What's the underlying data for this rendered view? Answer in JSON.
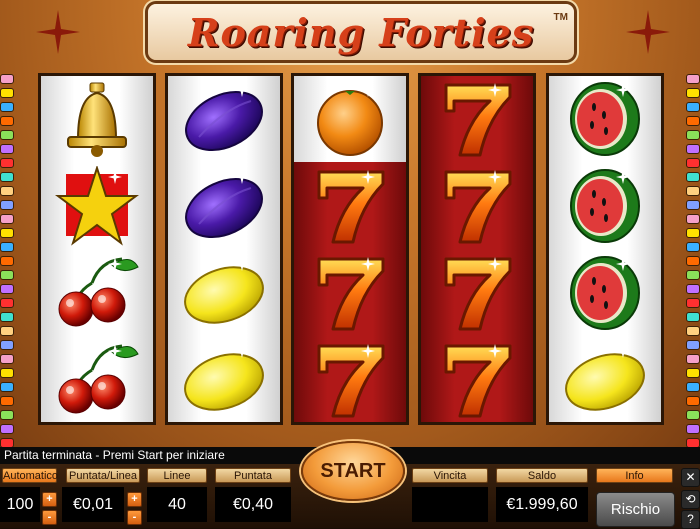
{
  "game": {
    "title": "Roaring Forties",
    "trademark": "TM"
  },
  "reels": [
    {
      "background": "white",
      "symbols": [
        "bell",
        "star",
        "cherries",
        "cherries"
      ]
    },
    {
      "background": "white",
      "symbols": [
        "plum",
        "plum",
        "lemon",
        "lemon"
      ]
    },
    {
      "background": "red",
      "symbols": [
        "orange",
        "seven",
        "seven",
        "seven"
      ]
    },
    {
      "background": "red",
      "symbols": [
        "seven",
        "seven",
        "seven",
        "seven"
      ]
    },
    {
      "background": "white",
      "symbols": [
        "watermelon",
        "watermelon",
        "watermelon",
        "lemon"
      ]
    }
  ],
  "status": {
    "message": "Partita terminata - Premi Start per iniziare"
  },
  "controls": {
    "auto": {
      "label": "Automatico",
      "value": "100"
    },
    "bet_per_line": {
      "label": "Puntata/Linea",
      "value": "€0,01"
    },
    "lines": {
      "label": "Linee",
      "value": "40"
    },
    "bet": {
      "label": "Puntata",
      "value": "€0,40"
    },
    "start": "START",
    "win": {
      "label": "Vincita",
      "value": ""
    },
    "balance": {
      "label": "Saldo",
      "value": "€1.999,60"
    },
    "info": "Info",
    "gamble": "Rischio",
    "plus": "+",
    "minus": "-"
  },
  "icons": [
    "close-icon",
    "sound-icon",
    "history-icon",
    "help-icon"
  ],
  "colors": {
    "accent": "#e8781c",
    "reel_red": "#b01818",
    "frame": "#c9782b"
  }
}
